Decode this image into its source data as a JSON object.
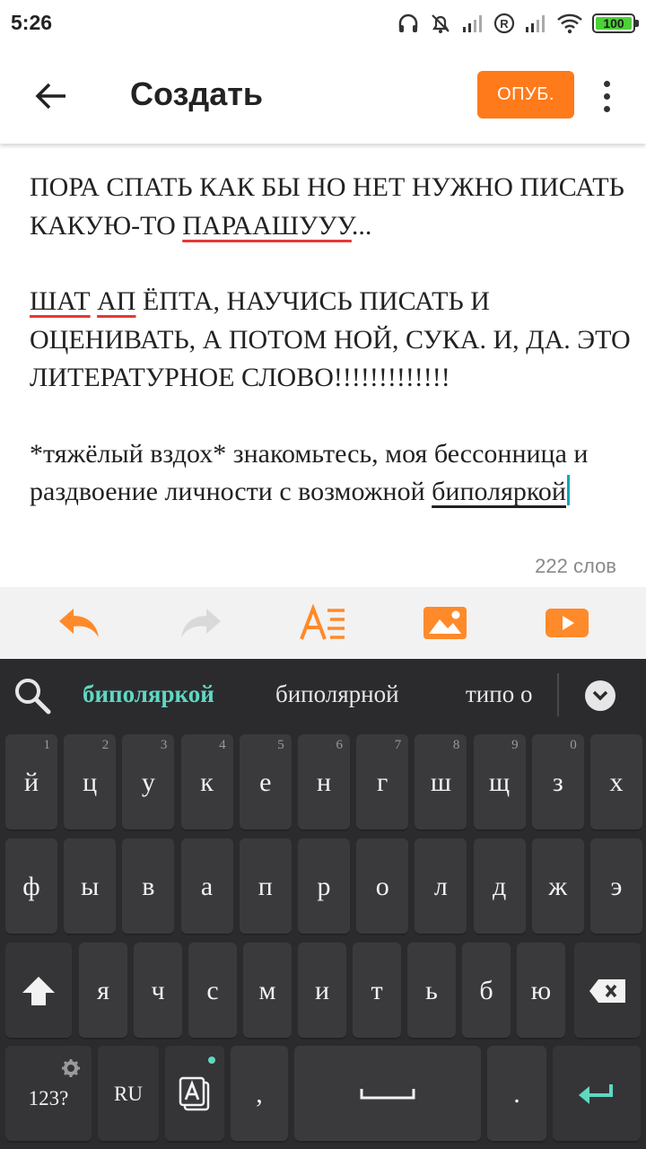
{
  "status_bar": {
    "time": "5:26",
    "battery": "100",
    "icons": [
      "headphones-icon",
      "bell-off-icon",
      "signal-icon",
      "roaming-icon",
      "signal-icon",
      "wifi-icon",
      "battery-icon"
    ]
  },
  "app_bar": {
    "title": "Создать",
    "publish_label": "ОПУБ.",
    "accent_color": "#ff7a1a"
  },
  "editor": {
    "paragraph1": {
      "before": "ПОРА СПАТЬ КАК БЫ НО НЕТ НУЖНО ПИСАТЬ КАКУЮ-ТО ",
      "misspelled": "ПАРААШУУУ",
      "after": "..."
    },
    "paragraph2": {
      "misspelled1": "ШАТ",
      "space": " ",
      "misspelled2": "АП",
      "after": " ЁПТА, НАУЧИСЬ ПИСАТЬ И ОЦЕНИВАТЬ, А ПОТОМ НОЙ, СУКА. И, ДА. ЭТО ЛИТЕРАТУРНОЕ СЛОВО!!!!!!!!!!!!!"
    },
    "paragraph3": {
      "before": "*тяжёлый вздох* знакомьтесь, моя бессонница и раздвоение личности с возможной ",
      "active_word": "биполяркой"
    },
    "word_count": "222 слов"
  },
  "toolbar": {
    "tools": [
      "undo-icon",
      "redo-icon",
      "text-format-icon",
      "image-icon",
      "video-icon"
    ]
  },
  "keyboard": {
    "suggestions": [
      "биполяркой",
      "биполярной",
      "типо о"
    ],
    "row1": [
      {
        "label": "й",
        "hint": "1"
      },
      {
        "label": "ц",
        "hint": "2"
      },
      {
        "label": "у",
        "hint": "3"
      },
      {
        "label": "к",
        "hint": "4"
      },
      {
        "label": "е",
        "hint": "5"
      },
      {
        "label": "н",
        "hint": "6"
      },
      {
        "label": "г",
        "hint": "7"
      },
      {
        "label": "ш",
        "hint": "8"
      },
      {
        "label": "щ",
        "hint": "9"
      },
      {
        "label": "з",
        "hint": "0"
      },
      {
        "label": "х",
        "hint": ""
      }
    ],
    "row2": [
      "ф",
      "ы",
      "в",
      "а",
      "п",
      "р",
      "о",
      "л",
      "д",
      "ж",
      "э"
    ],
    "row3": [
      "я",
      "ч",
      "с",
      "м",
      "и",
      "т",
      "ь",
      "б",
      "ю"
    ],
    "symbols_label": "123?",
    "language_label": "RU",
    "comma_label": ",",
    "period_label": "."
  }
}
